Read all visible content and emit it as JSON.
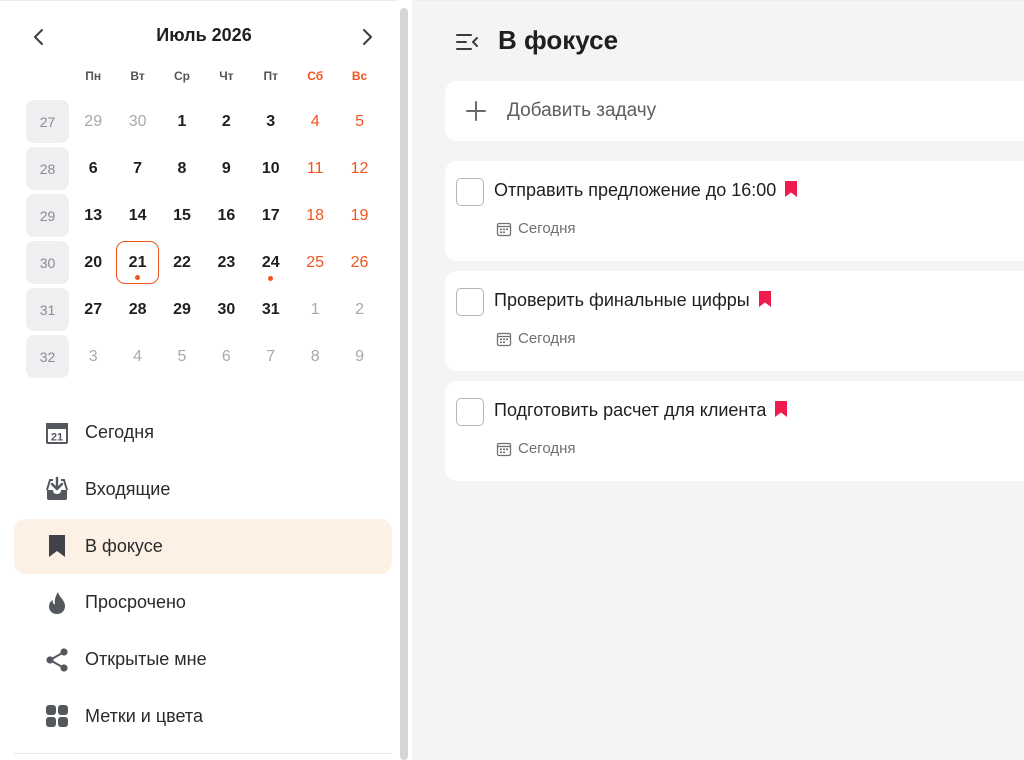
{
  "calendar": {
    "month_title": "Июль 2026",
    "weekdays": [
      {
        "label": "Пн",
        "weekend": false
      },
      {
        "label": "Вт",
        "weekend": false
      },
      {
        "label": "Ср",
        "weekend": false
      },
      {
        "label": "Чт",
        "weekend": false
      },
      {
        "label": "Пт",
        "weekend": false
      },
      {
        "label": "Сб",
        "weekend": true
      },
      {
        "label": "Вс",
        "weekend": true
      }
    ],
    "weeks": [
      {
        "num": "27",
        "days": [
          {
            "d": "29",
            "muted": true
          },
          {
            "d": "30",
            "muted": true
          },
          {
            "d": "1"
          },
          {
            "d": "2"
          },
          {
            "d": "3"
          },
          {
            "d": "4",
            "weekend": true
          },
          {
            "d": "5",
            "weekend": true
          }
        ]
      },
      {
        "num": "28",
        "days": [
          {
            "d": "6"
          },
          {
            "d": "7"
          },
          {
            "d": "8"
          },
          {
            "d": "9"
          },
          {
            "d": "10"
          },
          {
            "d": "11",
            "weekend": true
          },
          {
            "d": "12",
            "weekend": true
          }
        ]
      },
      {
        "num": "29",
        "days": [
          {
            "d": "13"
          },
          {
            "d": "14"
          },
          {
            "d": "15"
          },
          {
            "d": "16"
          },
          {
            "d": "17"
          },
          {
            "d": "18",
            "weekend": true
          },
          {
            "d": "19",
            "weekend": true
          }
        ]
      },
      {
        "num": "30",
        "days": [
          {
            "d": "20"
          },
          {
            "d": "21",
            "today": true,
            "dot": true
          },
          {
            "d": "22"
          },
          {
            "d": "23"
          },
          {
            "d": "24",
            "dot": true
          },
          {
            "d": "25",
            "weekend": true
          },
          {
            "d": "26",
            "weekend": true
          }
        ]
      },
      {
        "num": "31",
        "days": [
          {
            "d": "27"
          },
          {
            "d": "28"
          },
          {
            "d": "29"
          },
          {
            "d": "30"
          },
          {
            "d": "31"
          },
          {
            "d": "1",
            "muted": true
          },
          {
            "d": "2",
            "muted": true
          }
        ]
      },
      {
        "num": "32",
        "days": [
          {
            "d": "3",
            "muted": true
          },
          {
            "d": "4",
            "muted": true
          },
          {
            "d": "5",
            "muted": true
          },
          {
            "d": "6",
            "muted": true
          },
          {
            "d": "7",
            "muted": true
          },
          {
            "d": "8",
            "muted": true
          },
          {
            "d": "9",
            "muted": true
          }
        ]
      }
    ]
  },
  "sidebar": {
    "items": [
      {
        "label": "Сегодня",
        "icon": "calendar-today-icon",
        "icon_text": "21",
        "active": false
      },
      {
        "label": "Входящие",
        "icon": "inbox-icon",
        "active": false
      },
      {
        "label": "В фокусе",
        "icon": "bookmark-icon",
        "active": true
      },
      {
        "label": "Просрочено",
        "icon": "flame-icon",
        "active": false
      },
      {
        "label": "Открытые мне",
        "icon": "share-icon",
        "active": false
      },
      {
        "label": "Метки и цвета",
        "icon": "tags-grid-icon",
        "active": false
      }
    ]
  },
  "header": {
    "title": "В фокусе"
  },
  "add_task": {
    "placeholder": "Добавить задачу"
  },
  "tasks": [
    {
      "title": "Отправить предложение до 16:00",
      "date": "Сегодня",
      "flagged": true
    },
    {
      "title": "Проверить финальные цифры",
      "date": "Сегодня",
      "flagged": true
    },
    {
      "title": "Подготовить расчет для клиента",
      "date": "Сегодня",
      "flagged": true
    }
  ],
  "colors": {
    "accent": "#f0541c",
    "flag": "#ee1d4e",
    "active_bg": "#fdf0e4",
    "icon": "#54575e"
  }
}
